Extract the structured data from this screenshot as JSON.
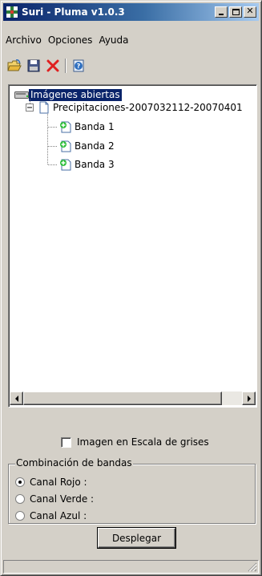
{
  "window": {
    "title": "Suri - Pluma v1.0.3",
    "colors": {
      "titlebar_start": "#0a246a",
      "titlebar_end": "#a6caf0",
      "face": "#d4d0c8",
      "selection": "#0a246a"
    }
  },
  "menu": {
    "items": [
      "Archivo",
      "Opciones",
      "Ayuda"
    ]
  },
  "toolbar": {
    "icons": [
      "open-folder-icon",
      "save-icon",
      "delete-icon",
      "help-icon"
    ]
  },
  "tree": {
    "root": {
      "label": "Imágenes abiertas",
      "icon": "drive-icon",
      "selected": true
    },
    "file": {
      "label": "Precipitaciones-2007032112-20070401",
      "icon": "document-icon",
      "expanded": true
    },
    "bands": [
      {
        "label": "Banda 1"
      },
      {
        "label": "Banda 2"
      },
      {
        "label": "Banda 3"
      }
    ]
  },
  "options": {
    "grayscale_label": "Imagen en Escala de grises",
    "grayscale_checked": false
  },
  "band_group": {
    "title": "Combinación de bandas",
    "channels": [
      {
        "label": "Canal Rojo :",
        "selected": true
      },
      {
        "label": "Canal Verde :",
        "selected": false
      },
      {
        "label": "Canal Azul :",
        "selected": false
      }
    ]
  },
  "actions": {
    "display_label": "Desplegar"
  }
}
